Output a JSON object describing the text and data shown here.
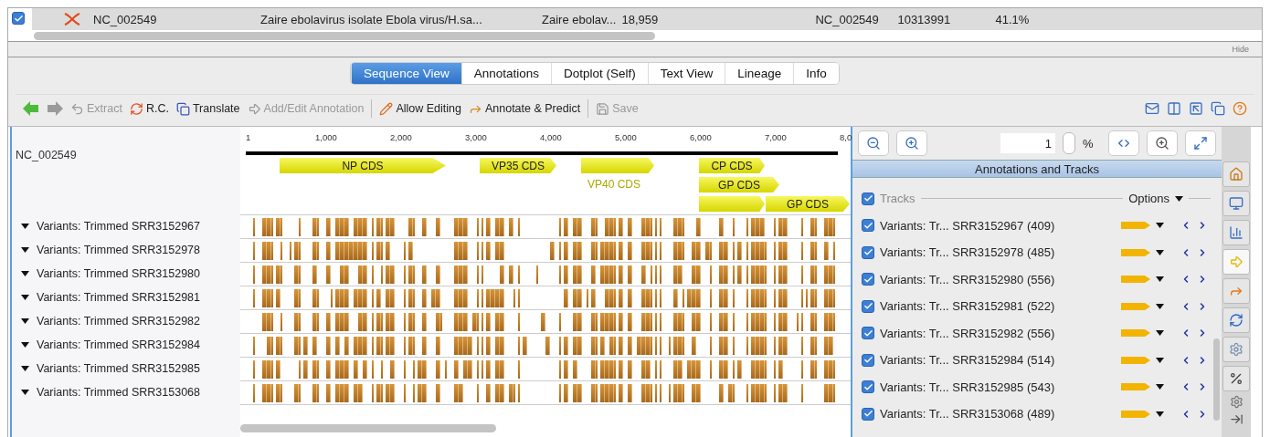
{
  "record_row": {
    "checked": true,
    "cells": [
      "NC_002549",
      "Zaire ebolavirus isolate Ebola virus/H.sa...",
      "Zaire ebolav...",
      "18,959",
      "NC_002549",
      "10313991",
      "41.1%"
    ]
  },
  "hide_label": "Hide",
  "tabs": [
    {
      "label": "Sequence View",
      "selected": true
    },
    {
      "label": "Annotations",
      "selected": false
    },
    {
      "label": "Dotplot (Self)",
      "selected": false
    },
    {
      "label": "Text View",
      "selected": false
    },
    {
      "label": "Lineage",
      "selected": false
    },
    {
      "label": "Info",
      "selected": false
    }
  ],
  "toolbar": [
    {
      "kind": "icon",
      "disabled": false
    },
    {
      "kind": "icon",
      "disabled": true
    },
    {
      "kind": "button",
      "label": "Extract",
      "disabled": true
    },
    {
      "kind": "button",
      "label": "R.C.",
      "disabled": false
    },
    {
      "kind": "button",
      "label": "Translate",
      "disabled": false
    },
    {
      "kind": "button",
      "label": "Add/Edit Annotation",
      "disabled": true
    },
    {
      "kind": "separator"
    },
    {
      "kind": "button",
      "label": "Allow Editing",
      "disabled": false
    },
    {
      "kind": "button",
      "label": "Annotate & Predict",
      "disabled": false
    },
    {
      "kind": "separator"
    },
    {
      "kind": "button",
      "label": "Save",
      "disabled": true
    }
  ],
  "sequence": {
    "name": "NC_002549",
    "ruler_ticks": [
      "1",
      "1,000",
      "2,000",
      "3,000",
      "4,000",
      "5,000",
      "6,000",
      "7,000",
      "8,0"
    ],
    "annotations": [
      {
        "kind": "inline",
        "label": "NP CDS"
      },
      {
        "kind": "inline",
        "label": "VP35 CDS"
      },
      {
        "kind": "below",
        "label": "VP40 CDS"
      },
      {
        "kind": "inline",
        "label": "CP CDS"
      },
      {
        "kind": "inline",
        "label": "GP CDS"
      },
      {
        "kind": "blank"
      },
      {
        "kind": "inline",
        "label": "GP CDS"
      }
    ]
  },
  "tracks": [
    {
      "name": "Variants: Trimmed SRR3152967",
      "expanded": true
    },
    {
      "name": "Variants: Trimmed SRR3152978",
      "expanded": true
    },
    {
      "name": "Variants: Trimmed SRR3152980",
      "expanded": true
    },
    {
      "name": "Variants: Trimmed SRR3152981",
      "expanded": true
    },
    {
      "name": "Variants: Trimmed SRR3152982",
      "expanded": true
    },
    {
      "name": "Variants: Trimmed SRR3152984",
      "expanded": true
    },
    {
      "name": "Variants: Trimmed SRR3152985",
      "expanded": true
    },
    {
      "name": "Variants: Trimmed SRR3153068",
      "expanded": true
    }
  ],
  "zoom": {
    "value": "1",
    "unit": "%"
  },
  "panel": {
    "title": "Annotations and Tracks",
    "tracks_header": {
      "label": "Tracks",
      "checked": true
    },
    "options": "Options",
    "tracks": [
      {
        "label": "Variants: Tr... SRR3152967 (409)",
        "checked": true
      },
      {
        "label": "Variants: Tr... SRR3152978 (485)",
        "checked": true
      },
      {
        "label": "Variants: Tr... SRR3152980 (556)",
        "checked": true
      },
      {
        "label": "Variants: Tr... SRR3152981 (522)",
        "checked": true
      },
      {
        "label": "Variants: Tr... SRR3152982 (556)",
        "checked": true
      },
      {
        "label": "Variants: Tr... SRR3152984 (514)",
        "checked": true
      },
      {
        "label": "Variants: Tr... SRR3152985 (543)",
        "checked": true
      },
      {
        "label": "Variants: Tr... SRR3153068 (489)",
        "checked": true
      }
    ]
  },
  "side_tabs": [
    {
      "selected": false
    },
    {
      "selected": false
    },
    {
      "selected": false
    },
    {
      "selected": true
    },
    {
      "selected": false
    },
    {
      "selected": false
    },
    {
      "selected": false
    },
    {
      "selected": false
    }
  ]
}
